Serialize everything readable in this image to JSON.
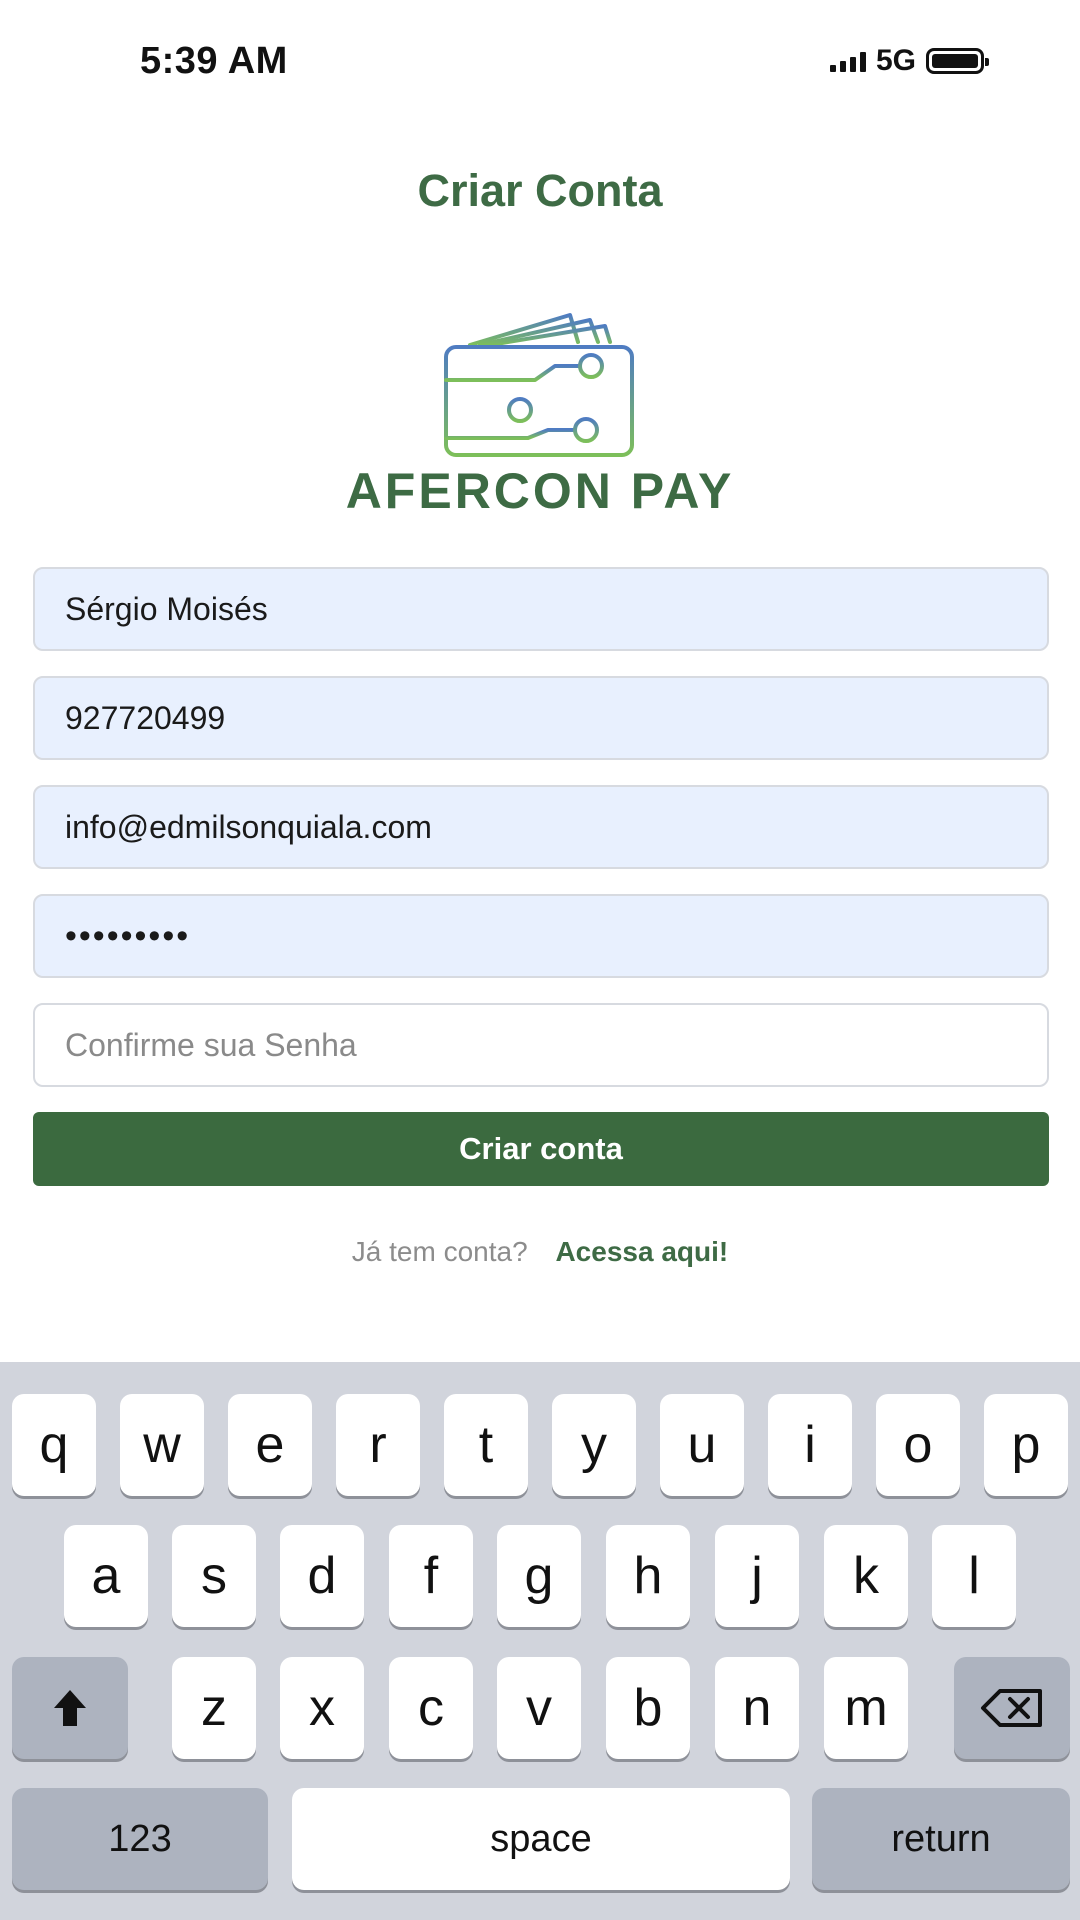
{
  "status_bar": {
    "time": "5:39 AM",
    "network": "5G"
  },
  "header": {
    "title": "Criar Conta"
  },
  "logo": {
    "icon": "wallet-circuit-icon",
    "brand": "AFERCON PAY"
  },
  "form": {
    "name_value": "Sérgio Moisés",
    "phone_value": "927720499",
    "email_value": "info@edmilsonquiala.com",
    "password_value": "•••••••••",
    "confirm_placeholder": "Confirme sua Senha",
    "submit_label": "Criar conta"
  },
  "footer": {
    "question": "Já tem conta?",
    "link": "Acessa aqui!"
  },
  "keyboard": {
    "row1": [
      "q",
      "w",
      "e",
      "r",
      "t",
      "y",
      "u",
      "i",
      "o",
      "p"
    ],
    "row2": [
      "a",
      "s",
      "d",
      "f",
      "g",
      "h",
      "j",
      "k",
      "l"
    ],
    "row3": [
      "z",
      "x",
      "c",
      "v",
      "b",
      "n",
      "m"
    ],
    "shift_icon": "shift-arrow-icon",
    "backspace_icon": "backspace-icon",
    "numbers_label": "123",
    "space_label": "space",
    "return_label": "return"
  },
  "colors": {
    "brand_green": "#3b6a3f",
    "field_fill": "#e8f0fe",
    "keyboard_bg": "#d1d4dc"
  }
}
